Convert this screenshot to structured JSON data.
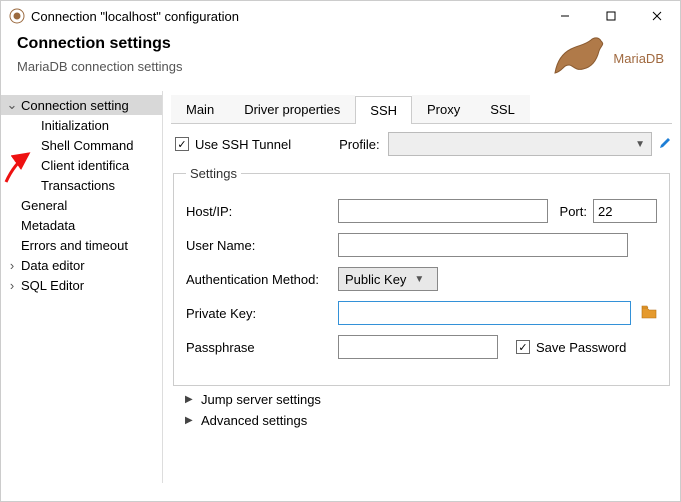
{
  "window": {
    "title": "Connection \"localhost\" configuration"
  },
  "header": {
    "title": "Connection settings",
    "subtitle": "MariaDB connection settings",
    "brand": "MariaDB"
  },
  "sidebar": {
    "items": [
      {
        "label": "Connection setting",
        "depth": 1,
        "expandable": true,
        "expanded": true,
        "selected": true
      },
      {
        "label": "Initialization",
        "depth": 2
      },
      {
        "label": "Shell Command",
        "depth": 2
      },
      {
        "label": "Client identifica",
        "depth": 2
      },
      {
        "label": "Transactions",
        "depth": 2
      },
      {
        "label": "General",
        "depth": 1
      },
      {
        "label": "Metadata",
        "depth": 1
      },
      {
        "label": "Errors and timeout",
        "depth": 1
      },
      {
        "label": "Data editor",
        "depth": 1,
        "expandable": true,
        "expanded": false
      },
      {
        "label": "SQL Editor",
        "depth": 1,
        "expandable": true,
        "expanded": false
      }
    ]
  },
  "tabs": {
    "items": [
      "Main",
      "Driver properties",
      "SSH",
      "Proxy",
      "SSL"
    ],
    "active": "SSH"
  },
  "ssh": {
    "use_tunnel_label": "Use SSH Tunnel",
    "use_tunnel_checked": true,
    "profile_label": "Profile:",
    "profile_value": "",
    "settings_legend": "Settings",
    "host_label": "Host/IP:",
    "host_value": "",
    "port_label": "Port:",
    "port_value": "22",
    "user_label": "User Name:",
    "user_value": "",
    "auth_label": "Authentication Method:",
    "auth_value": "Public Key",
    "pk_label": "Private Key:",
    "pk_value": "",
    "pass_label": "Passphrase",
    "pass_value": "",
    "save_pw_label": "Save Password",
    "save_pw_checked": true,
    "jump_label": "Jump server settings",
    "advanced_label": "Advanced settings"
  }
}
